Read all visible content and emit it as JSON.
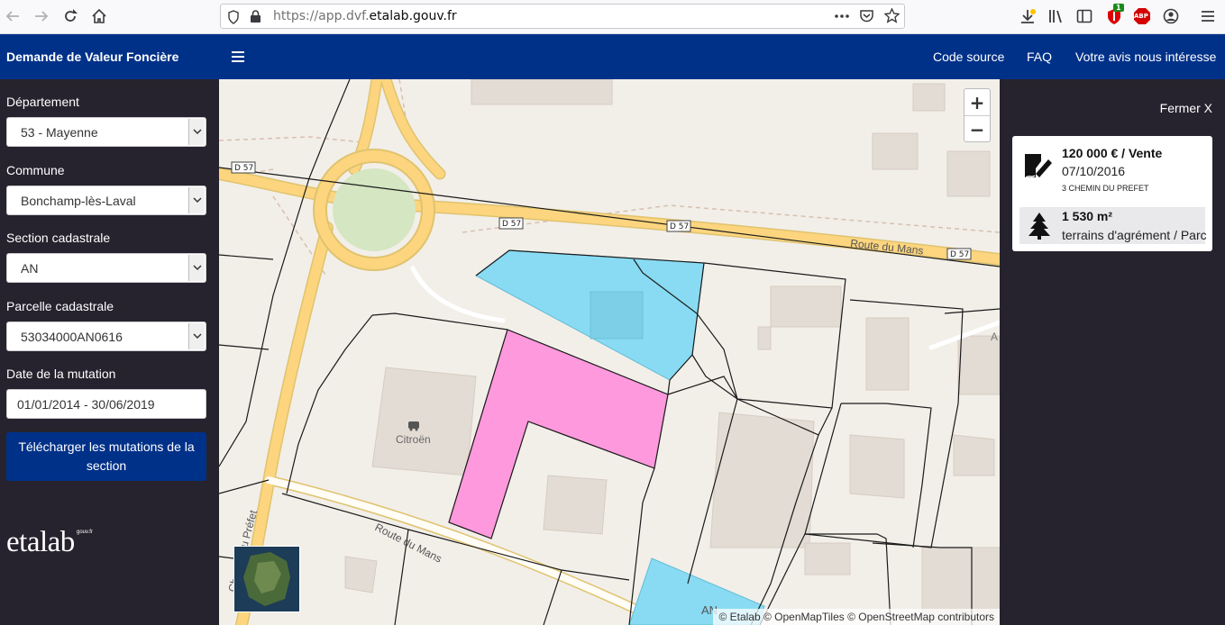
{
  "browser": {
    "url_prefix": "https://app.dvf.",
    "url_domain": "etalab.gouv.fr",
    "ext_badge": "1",
    "abp_label": "ABP"
  },
  "app": {
    "title": "Demande de Valeur Foncière"
  },
  "nav": {
    "links": [
      "Code source",
      "FAQ",
      "Votre avis nous intéresse"
    ]
  },
  "form": {
    "departement_label": "Département",
    "departement_value": "53 - Mayenne",
    "commune_label": "Commune",
    "commune_value": "Bonchamp-lès-Laval",
    "section_label": "Section cadastrale",
    "section_value": "AN",
    "parcelle_label": "Parcelle cadastrale",
    "parcelle_value": "53034000AN0616",
    "date_label": "Date de la mutation",
    "date_value": "01/01/2014 - 30/06/2019",
    "download_label": "Télécharger les mutations de la section"
  },
  "logo": {
    "text": "etalab",
    "suffix": "gouv.fr"
  },
  "map": {
    "road_labels": [
      "D 57",
      "D 57",
      "D 57",
      "D 57"
    ],
    "street_route_du_mans": "Route du Mans",
    "street_route_du_mans_2": "Route du Mans",
    "street_chemin_du_prefet": "Chemin du Préfet",
    "poi_label": "Citroën",
    "parcel_label": "AN",
    "edge_label": "A",
    "attribution": "© Etalab © OpenMapTiles © OpenStreetMap contributors",
    "colors": {
      "selected_parcel": "#ff99dd",
      "sold_parcel": "#88dbf2",
      "road": "#fcd57e",
      "background": "#f2efe9"
    }
  },
  "panel": {
    "close_label": "Fermer X",
    "sale": {
      "price": "120 000 € / Vente",
      "date": "07/10/2016",
      "address": "3 CHEMIN DU PREFET",
      "area": "1 530 m²",
      "nature": "terrains d'agrément / Parc"
    }
  }
}
